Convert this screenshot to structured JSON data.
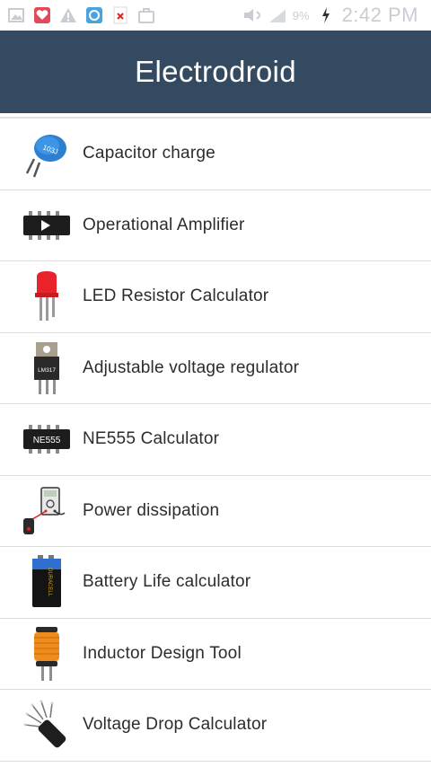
{
  "status_bar": {
    "battery_percent": "9%",
    "time": "2:42 PM",
    "icons": [
      "gallery-icon",
      "heart-shield-icon",
      "warning-icon",
      "refresh-app-icon",
      "close-notification-icon",
      "bag-icon",
      "mute-icon",
      "signal-icon",
      "charging-icon"
    ]
  },
  "app_bar": {
    "title": "Electrodroid"
  },
  "colors": {
    "app_bar": "#344a60",
    "status_bar_text": "#c9cdd3",
    "divider": "#dcdcdc"
  },
  "menu": {
    "items": [
      {
        "label": "Capacitor charge",
        "icon": "capacitor-icon"
      },
      {
        "label": "Operational Amplifier",
        "icon": "op-amp-chip-icon"
      },
      {
        "label": "LED Resistor Calculator",
        "icon": "led-icon"
      },
      {
        "label": "Adjustable voltage regulator",
        "icon": "voltage-regulator-icon",
        "icon_text": "LM317"
      },
      {
        "label": "NE555 Calculator",
        "icon": "ne555-chip-icon",
        "icon_text": "NE555"
      },
      {
        "label": "Power dissipation",
        "icon": "multimeter-icon"
      },
      {
        "label": "Battery Life calculator",
        "icon": "battery-icon",
        "icon_text": "DURACELL"
      },
      {
        "label": "Inductor Design Tool",
        "icon": "inductor-icon"
      },
      {
        "label": "Voltage Drop Calculator",
        "icon": "wire-cable-icon"
      }
    ]
  }
}
